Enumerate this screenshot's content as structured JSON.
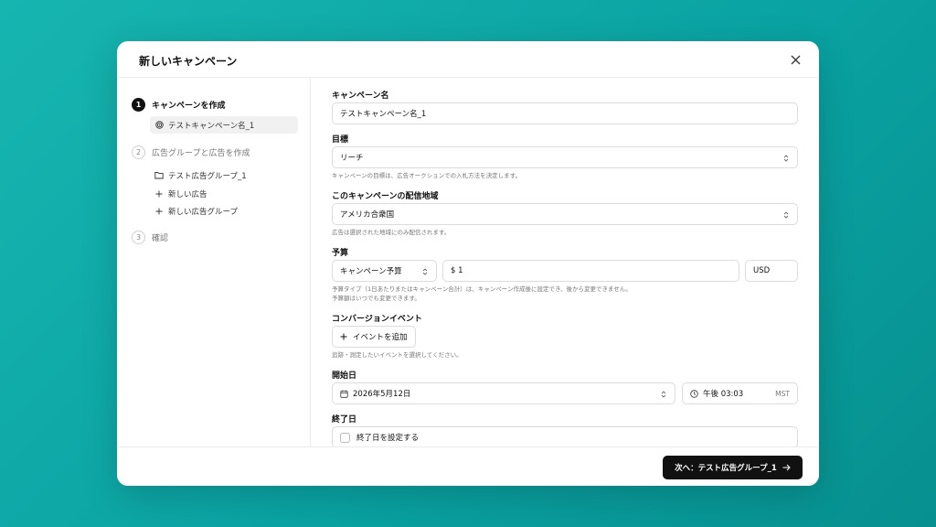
{
  "modal": {
    "title": "新しいキャンペーン"
  },
  "steps": [
    {
      "num": "1",
      "label": "キャンペーンを作成"
    },
    {
      "num": "2",
      "label": "広告グループと広告を作成"
    },
    {
      "num": "3",
      "label": "確認"
    }
  ],
  "sidebar_items": {
    "campaign": "テストキャンペーン名_1",
    "ad_group": "テスト広告グループ_1",
    "new_ad": "新しい広告",
    "new_ad_group": "新しい広告グループ"
  },
  "form": {
    "campaign_name": {
      "label": "キャンペーン名",
      "value": "テストキャンペーン名_1"
    },
    "objective": {
      "label": "目標",
      "value": "リーチ",
      "help": "キャンペーンの目標は、広告オークションでの入札方法を決定します。"
    },
    "region": {
      "label": "このキャンペーンの配信地域",
      "value": "アメリカ合衆国",
      "help": "広告は選択された地域にのみ配信されます。"
    },
    "budget": {
      "label": "予算",
      "type": "キャンペーン予算",
      "amount": "$ 1",
      "currency": "USD",
      "help1": "予算タイプ（1日あたりまたはキャンペーン合計）は、キャンペーン作成後に設定でき、後から変更できません。",
      "help2": "予算額はいつでも変更できます。"
    },
    "conversion": {
      "label": "コンバージョンイベント",
      "button": "イベントを追加",
      "help": "追跡・測定したいイベントを選択してください。"
    },
    "start": {
      "label": "開始日",
      "date": "2026年5月12日",
      "time": "午後 03:03",
      "tz": "MST"
    },
    "end": {
      "label": "終了日",
      "checkbox": "終了日を設定する"
    }
  },
  "footer": {
    "next_label": "次へ：テスト広告グループ_1"
  }
}
